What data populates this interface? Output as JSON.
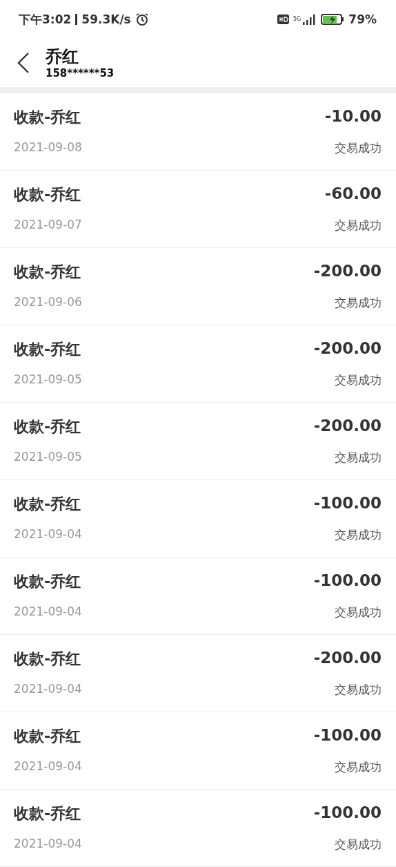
{
  "status_bar": {
    "time": "下午3:02",
    "speed": "59.3K/s",
    "network": "5G",
    "battery": "79%"
  },
  "header": {
    "title": "乔红",
    "subtitle": "158******53"
  },
  "transactions": [
    {
      "title": "收款-乔红",
      "amount": "-10.00",
      "date": "2021-09-08",
      "status": "交易成功"
    },
    {
      "title": "收款-乔红",
      "amount": "-60.00",
      "date": "2021-09-07",
      "status": "交易成功"
    },
    {
      "title": "收款-乔红",
      "amount": "-200.00",
      "date": "2021-09-06",
      "status": "交易成功"
    },
    {
      "title": "收款-乔红",
      "amount": "-200.00",
      "date": "2021-09-05",
      "status": "交易成功"
    },
    {
      "title": "收款-乔红",
      "amount": "-200.00",
      "date": "2021-09-05",
      "status": "交易成功"
    },
    {
      "title": "收款-乔红",
      "amount": "-100.00",
      "date": "2021-09-04",
      "status": "交易成功"
    },
    {
      "title": "收款-乔红",
      "amount": "-100.00",
      "date": "2021-09-04",
      "status": "交易成功"
    },
    {
      "title": "收款-乔红",
      "amount": "-200.00",
      "date": "2021-09-04",
      "status": "交易成功"
    },
    {
      "title": "收款-乔红",
      "amount": "-100.00",
      "date": "2021-09-04",
      "status": "交易成功"
    },
    {
      "title": "收款-乔红",
      "amount": "-100.00",
      "date": "2021-09-04",
      "status": "交易成功"
    }
  ]
}
